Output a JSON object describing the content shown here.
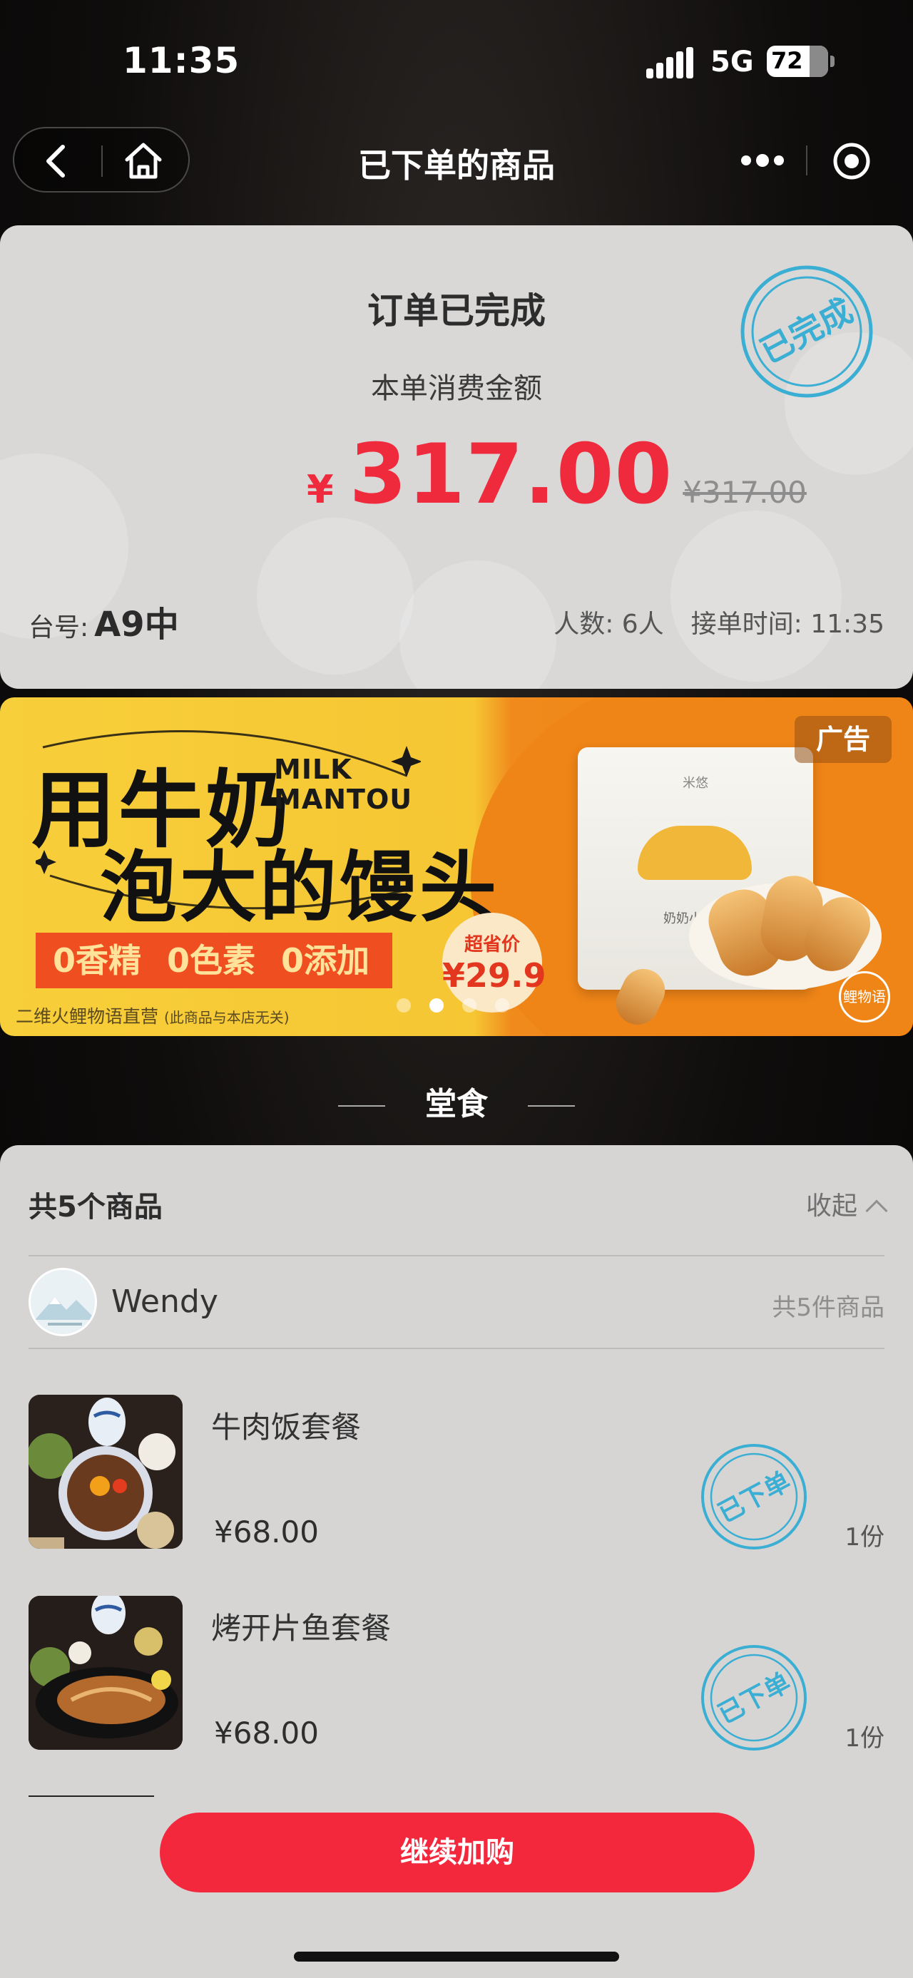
{
  "status_bar": {
    "time": "11:35",
    "network": "5G",
    "battery": "72"
  },
  "nav": {
    "title": "已下单的商品"
  },
  "order": {
    "status": "订单已完成",
    "amount_label": "本单消费金额",
    "currency": "¥",
    "amount": "317.00",
    "original_amount": "¥317.00",
    "stamp": "已完成",
    "table_label": "台号:",
    "table_value": "A9中",
    "people": "人数: 6人",
    "accept_time": "接单时间: 11:35"
  },
  "ad": {
    "headline_line1": "用牛奶",
    "headline_line2": "泡大的馒头",
    "english_line1": "MILK",
    "english_line2": "MANTOU",
    "tags": [
      "0香精",
      "0色素",
      "0添加"
    ],
    "footer": "二维火鲤物语直营",
    "footer_note": "(此商品与本店无关)",
    "price_label": "超省价",
    "price_value": "¥29.9",
    "badge": "广告",
    "bag_brand": "米悠",
    "bag_name": "奶奶小馒头",
    "logo": "鲤物语",
    "slides": 4,
    "active_slide": 2
  },
  "section": {
    "title": "堂食"
  },
  "goods": {
    "count_label": "共5个商品",
    "collapse_label": "收起",
    "user": {
      "name": "Wendy",
      "total": "共5件商品"
    },
    "items": [
      {
        "name": "牛肉饭套餐",
        "price": "¥68.00",
        "qty": "1份",
        "stamp": "已下单"
      },
      {
        "name": "烤开片鱼套餐",
        "price": "¥68.00",
        "qty": "1份",
        "stamp": "已下单"
      }
    ]
  },
  "cta": {
    "label": "继续加购"
  },
  "colors": {
    "accent_red": "#ee2a3c",
    "stamp_blue": "#3aaed3",
    "ad_yellow": "#f7cf3a",
    "ad_orange": "#f08517"
  }
}
